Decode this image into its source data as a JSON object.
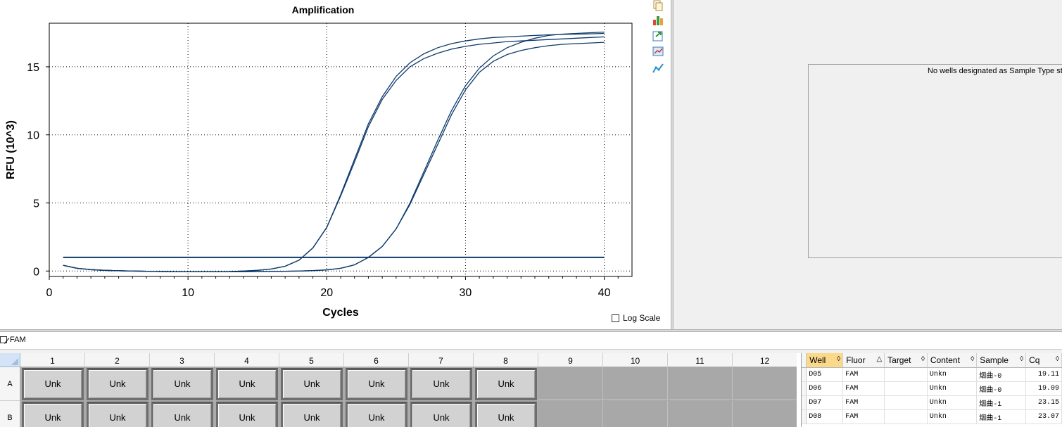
{
  "chart_data": {
    "type": "line",
    "title": "Amplification",
    "xlabel": "Cycles",
    "ylabel": "RFU (10^3)",
    "xlim": [
      0,
      42
    ],
    "ylim": [
      -0.4,
      18.2
    ],
    "xticks": [
      0,
      10,
      20,
      30,
      40
    ],
    "yticks": [
      0,
      5,
      10,
      15
    ],
    "grid": true,
    "threshold": 1.0,
    "threshold_x": [
      1,
      40
    ],
    "series": [
      {
        "x": [
          1,
          2,
          3,
          4,
          5,
          6,
          7,
          8,
          9,
          10,
          11,
          12,
          13,
          14,
          15,
          16,
          17,
          18,
          19,
          20,
          21,
          22,
          23,
          24,
          25,
          26,
          27,
          28,
          29,
          30,
          31,
          32,
          33,
          34,
          35,
          36,
          37,
          38,
          39,
          40
        ],
        "y": [
          0.42,
          0.2,
          0.1,
          0.05,
          0.02,
          0.0,
          -0.02,
          -0.04,
          -0.05,
          -0.06,
          -0.06,
          -0.05,
          -0.04,
          0.0,
          0.05,
          0.15,
          0.35,
          0.8,
          1.7,
          3.2,
          5.6,
          8.2,
          10.8,
          12.8,
          14.3,
          15.3,
          15.95,
          16.4,
          16.7,
          16.9,
          17.05,
          17.15,
          17.2,
          17.25,
          17.3,
          17.35,
          17.38,
          17.4,
          17.42,
          17.45
        ],
        "color": "#0d3a6b"
      },
      {
        "x": [
          1,
          2,
          3,
          4,
          5,
          6,
          7,
          8,
          9,
          10,
          11,
          12,
          13,
          14,
          15,
          16,
          17,
          18,
          19,
          20,
          21,
          22,
          23,
          24,
          25,
          26,
          27,
          28,
          29,
          30,
          31,
          32,
          33,
          34,
          35,
          36,
          37,
          38,
          39,
          40
        ],
        "y": [
          0.42,
          0.2,
          0.1,
          0.05,
          0.02,
          0.0,
          -0.02,
          -0.04,
          -0.05,
          -0.06,
          -0.06,
          -0.05,
          -0.04,
          0.0,
          0.05,
          0.15,
          0.35,
          0.8,
          1.7,
          3.2,
          5.5,
          8.0,
          10.6,
          12.6,
          14.0,
          15.0,
          15.6,
          16.0,
          16.3,
          16.5,
          16.65,
          16.75,
          16.85,
          16.9,
          16.95,
          17.0,
          17.05,
          17.1,
          17.15,
          17.2
        ],
        "color": "#0d3a6b"
      },
      {
        "x": [
          1,
          2,
          3,
          4,
          5,
          6,
          7,
          8,
          9,
          10,
          11,
          12,
          13,
          14,
          15,
          16,
          17,
          18,
          19,
          20,
          21,
          22,
          23,
          24,
          25,
          26,
          27,
          28,
          29,
          30,
          31,
          32,
          33,
          34,
          35,
          36,
          37,
          38,
          39,
          40
        ],
        "y": [
          0.42,
          0.2,
          0.1,
          0.05,
          0.02,
          0.0,
          -0.02,
          -0.04,
          -0.05,
          -0.06,
          -0.06,
          -0.06,
          -0.06,
          -0.05,
          -0.04,
          -0.03,
          -0.02,
          0.0,
          0.03,
          0.08,
          0.2,
          0.45,
          1.0,
          1.8,
          3.1,
          5.0,
          7.3,
          9.6,
          11.8,
          13.6,
          14.9,
          15.8,
          16.4,
          16.8,
          17.1,
          17.3,
          17.4,
          17.45,
          17.5,
          17.55
        ],
        "color": "#0d3a6b"
      },
      {
        "x": [
          1,
          2,
          3,
          4,
          5,
          6,
          7,
          8,
          9,
          10,
          11,
          12,
          13,
          14,
          15,
          16,
          17,
          18,
          19,
          20,
          21,
          22,
          23,
          24,
          25,
          26,
          27,
          28,
          29,
          30,
          31,
          32,
          33,
          34,
          35,
          36,
          37,
          38,
          39,
          40
        ],
        "y": [
          0.42,
          0.2,
          0.1,
          0.05,
          0.02,
          0.0,
          -0.02,
          -0.04,
          -0.05,
          -0.06,
          -0.06,
          -0.06,
          -0.06,
          -0.05,
          -0.04,
          -0.03,
          -0.02,
          0.0,
          0.03,
          0.08,
          0.2,
          0.45,
          1.0,
          1.8,
          3.1,
          4.9,
          7.1,
          9.3,
          11.5,
          13.3,
          14.6,
          15.4,
          15.9,
          16.2,
          16.4,
          16.55,
          16.65,
          16.7,
          16.75,
          16.8
        ],
        "color": "#0d3a6b"
      }
    ]
  },
  "toolbar": {
    "icons": [
      "copy-icon",
      "chart-settings-icon",
      "export-icon",
      "zoom-icon",
      "trend-icon"
    ]
  },
  "standard_panel": {
    "message": "No wells designated as Sample Type sta"
  },
  "log_scale": {
    "label": "Log Scale",
    "checked": false
  },
  "fluor": {
    "label": "FAM",
    "checked": true
  },
  "plate": {
    "columns": [
      "1",
      "2",
      "3",
      "4",
      "5",
      "6",
      "7",
      "8",
      "9",
      "10",
      "11",
      "12"
    ],
    "rows": [
      {
        "label": "A",
        "wells": [
          "Unk",
          "Unk",
          "Unk",
          "Unk",
          "Unk",
          "Unk",
          "Unk",
          "Unk",
          "",
          "",
          "",
          ""
        ]
      },
      {
        "label": "B",
        "wells": [
          "Unk",
          "Unk",
          "Unk",
          "Unk",
          "Unk",
          "Unk",
          "Unk",
          "Unk",
          "",
          "",
          "",
          ""
        ]
      }
    ]
  },
  "well_table": {
    "headers": [
      "Well",
      "Fluor",
      "Target",
      "Content",
      "Sample",
      "Cq"
    ],
    "rows": [
      [
        "D05",
        "FAM",
        "",
        "Unkn",
        "烟曲-0",
        "19.11"
      ],
      [
        "D06",
        "FAM",
        "",
        "Unkn",
        "烟曲-0",
        "19.09"
      ],
      [
        "D07",
        "FAM",
        "",
        "Unkn",
        "烟曲-1",
        "23.15"
      ],
      [
        "D08",
        "FAM",
        "",
        "Unkn",
        "烟曲-1",
        "23.07"
      ]
    ]
  },
  "colors": {
    "curve": "#0d3a6b",
    "grid": "#000000",
    "empty_well": "#a8a8a8",
    "sorted_header": "#fbd98a"
  }
}
